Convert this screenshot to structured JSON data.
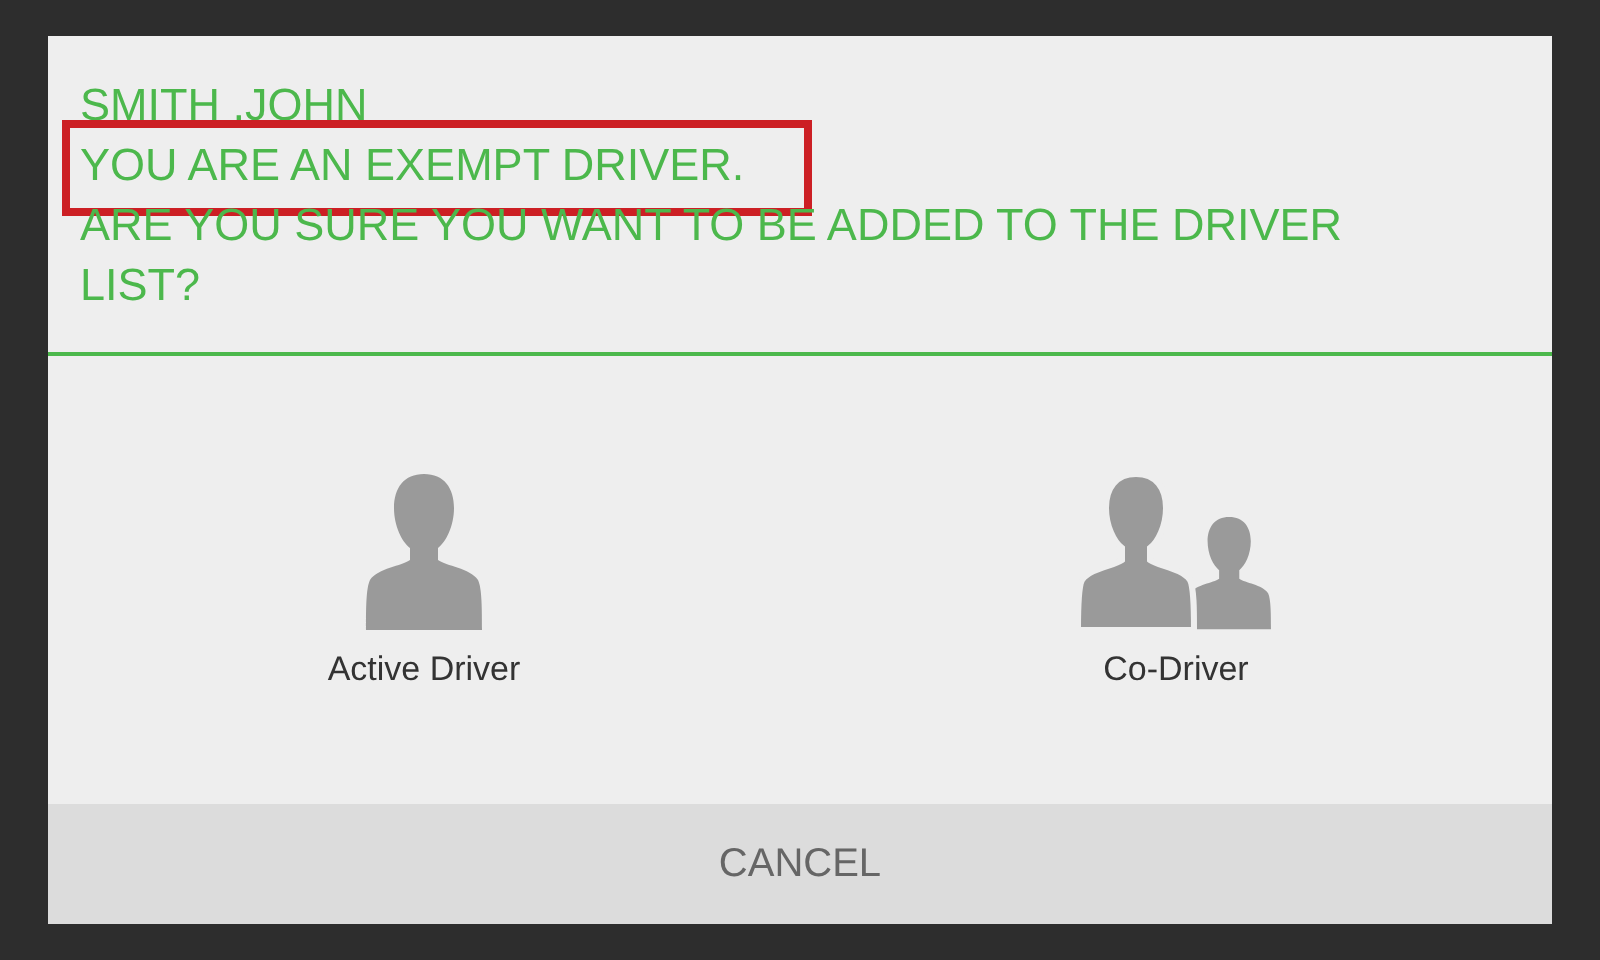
{
  "dialog": {
    "lines": [
      {
        "text": "SMITH ,JOHN",
        "highlighted": false
      },
      {
        "text": "YOU ARE AN EXEMPT DRIVER.",
        "highlighted": true
      },
      {
        "text": "ARE YOU SURE YOU WANT TO BE ADDED TO THE DRIVER LIST?",
        "highlighted": false
      }
    ],
    "options": [
      {
        "kind": "single",
        "label": "Active Driver"
      },
      {
        "kind": "pair",
        "label": "Co-Driver"
      }
    ],
    "cancel": "CANCEL"
  }
}
